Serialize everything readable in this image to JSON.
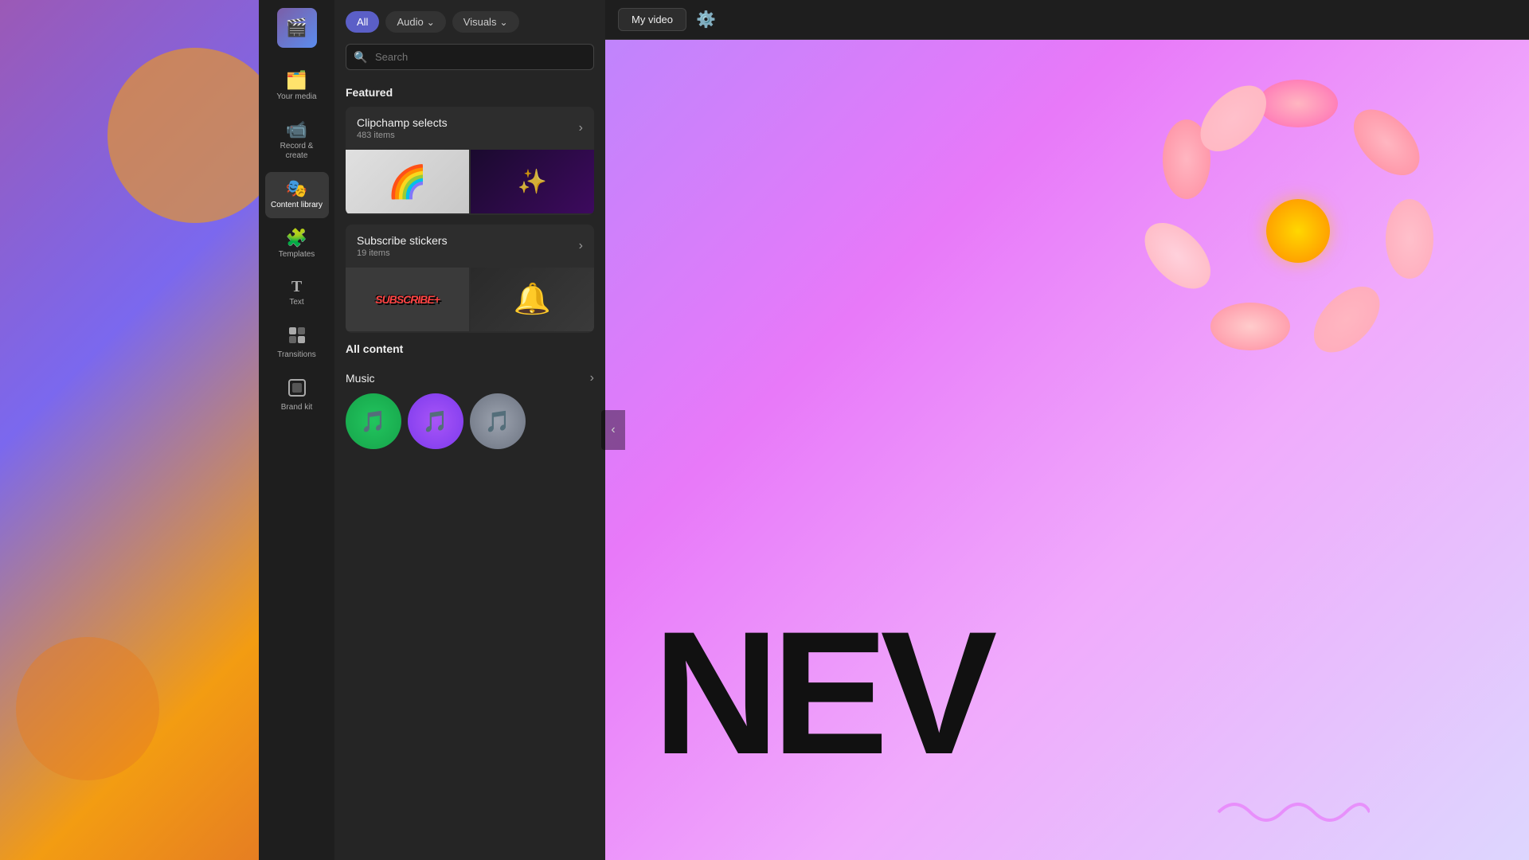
{
  "app": {
    "logo_emoji": "🎬"
  },
  "sidebar": {
    "items": [
      {
        "id": "your-media",
        "label": "Your media",
        "icon": "🗂️",
        "active": false
      },
      {
        "id": "record-create",
        "label": "Record &\ncreate",
        "icon": "📹",
        "active": false
      },
      {
        "id": "content-library",
        "label": "Content library",
        "icon": "🎭",
        "active": true
      },
      {
        "id": "templates",
        "label": "Templates",
        "icon": "🧩",
        "active": false
      },
      {
        "id": "text",
        "label": "Text",
        "icon": "T",
        "active": false
      },
      {
        "id": "transitions",
        "label": "Transitions",
        "icon": "⊞",
        "active": false
      },
      {
        "id": "brand-kit",
        "label": "Brand kit",
        "icon": "⊡",
        "active": false
      }
    ]
  },
  "filter_bar": {
    "all_label": "All",
    "audio_label": "Audio",
    "visuals_label": "Visuals"
  },
  "search": {
    "placeholder": "Search"
  },
  "panel": {
    "featured_heading": "Featured",
    "all_content_heading": "All content",
    "clipchamp_selects": {
      "title": "Clipchamp selects",
      "subtitle": "483 items"
    },
    "subscribe_stickers": {
      "title": "Subscribe stickers",
      "subtitle": "19 items"
    },
    "music": {
      "title": "Music"
    }
  },
  "preview": {
    "video_title": "My video",
    "new_text": "NEV"
  },
  "scroll": {
    "indicator": "‹"
  }
}
